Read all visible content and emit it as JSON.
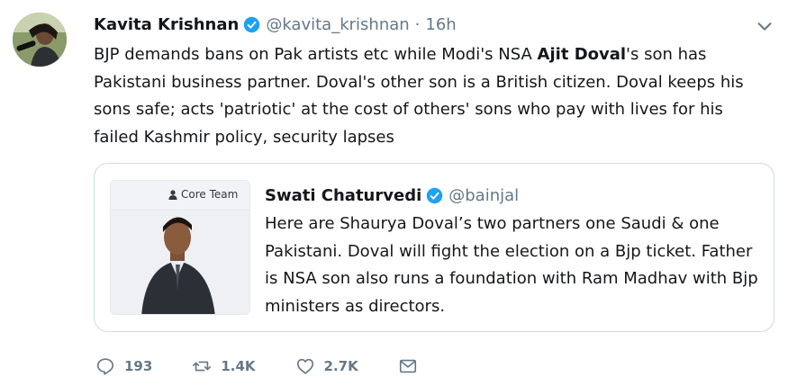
{
  "tweet": {
    "author_name": "Kavita Krishnan",
    "handle": "@kavita_krishnan",
    "separator": "·",
    "time": "16h",
    "text_before_bold": "BJP demands bans on Pak artists etc while Modi's NSA ",
    "text_bold": "Ajit Doval",
    "text_after_bold": "'s son has Pakistani business partner. Doval's other son is a British citizen. Doval keeps his sons safe; acts 'patriotic' at the cost of others' sons who pay with lives for his failed Kashmir policy, security lapses"
  },
  "quoted": {
    "author_name": "Swati Chaturvedi",
    "handle": "@bainjal",
    "image_badge": "Core Team",
    "text": "Here are Shaurya Doval’s two partners one Saudi & one Pakistani. Doval will fight the election on a Bjp ticket. Father is NSA son also runs a foundation with Ram Madhav with Bjp ministers as directors."
  },
  "actions": {
    "reply_count": "193",
    "retweet_count": "1.4K",
    "like_count": "2.7K"
  },
  "icons": {
    "verified": "verified-badge-icon",
    "menu": "chevron-down-icon",
    "reply": "reply-icon",
    "retweet": "retweet-icon",
    "like": "heart-icon",
    "dm": "envelope-icon"
  },
  "colors": {
    "verified_blue": "#1da1f2",
    "text": "#14171a",
    "muted": "#657786",
    "border": "#cfd9de"
  }
}
